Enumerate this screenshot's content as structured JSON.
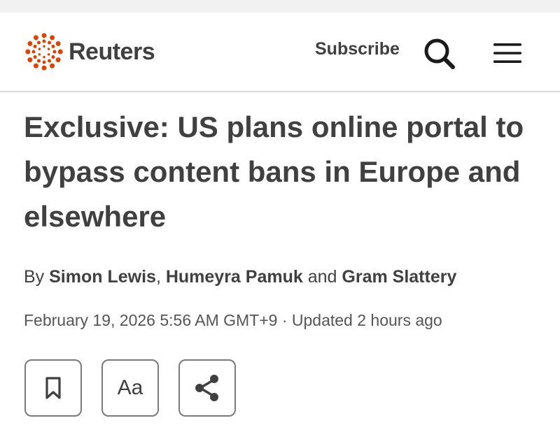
{
  "header": {
    "logo_text": "Reuters",
    "subscribe_label": "Subscribe",
    "search_icon": "search-icon",
    "menu_icon": "hamburger-menu-icon",
    "brand_color": "#dc4300"
  },
  "article": {
    "headline": "Exclusive: US plans online portal to bypass content bans in Europe and elsewhere",
    "byline": {
      "prefix": "By ",
      "author1": "Simon Lewis",
      "sep1": ", ",
      "author2": "Humeyra Pamuk",
      "sep2": " and ",
      "author3": "Gram Slattery"
    },
    "meta": "February 19, 2026 5:56 AM GMT+9 · Updated 2 hours ago"
  },
  "actions": {
    "bookmark_icon": "bookmark-icon",
    "text_size_label": "Aa",
    "share_icon": "share-icon"
  }
}
